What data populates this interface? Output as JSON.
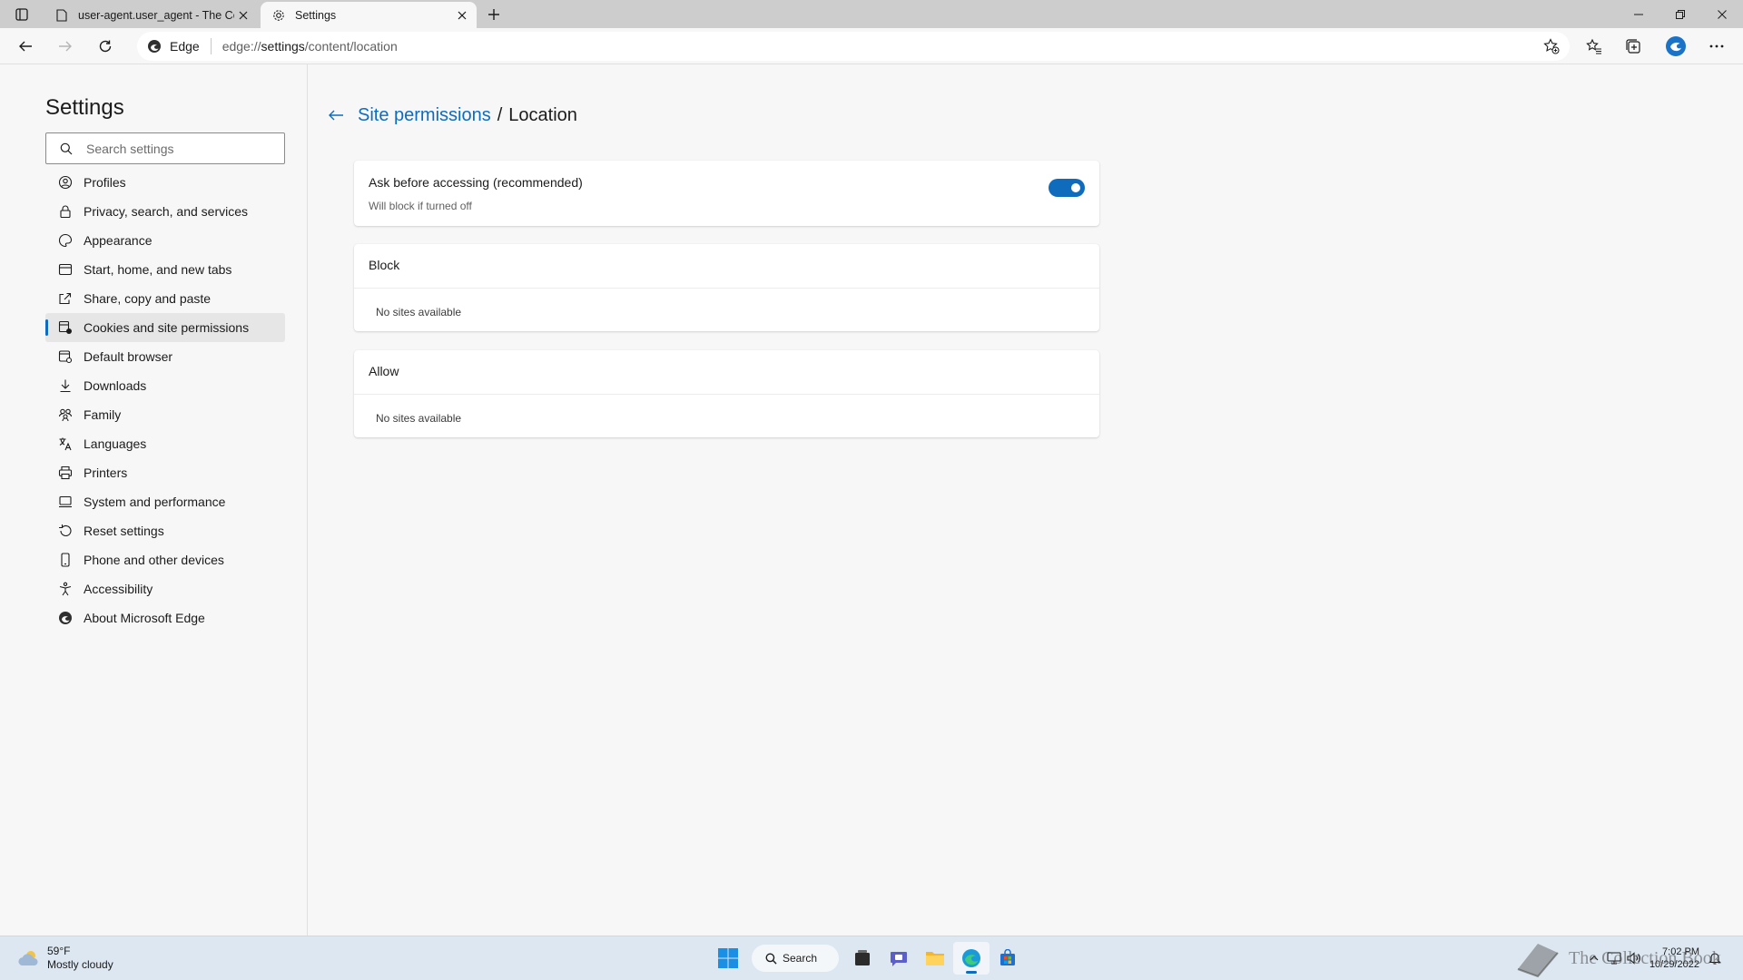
{
  "browser": {
    "tabs": [
      {
        "title": "user-agent.user_agent - The Coll",
        "active": false,
        "icon": "page-icon"
      },
      {
        "title": "Settings",
        "active": true,
        "icon": "gear-icon"
      }
    ],
    "address_label": "Edge",
    "url_prefix": "edge://",
    "url_main": "settings",
    "url_rest": "/content/location"
  },
  "sidebar": {
    "title": "Settings",
    "search_placeholder": "Search settings",
    "items": [
      {
        "label": "Profiles",
        "icon": "profile-icon"
      },
      {
        "label": "Privacy, search, and services",
        "icon": "lock-icon"
      },
      {
        "label": "Appearance",
        "icon": "appearance-icon"
      },
      {
        "label": "Start, home, and new tabs",
        "icon": "home-tabs-icon"
      },
      {
        "label": "Share, copy and paste",
        "icon": "share-icon"
      },
      {
        "label": "Cookies and site permissions",
        "icon": "cookies-icon",
        "selected": true
      },
      {
        "label": "Default browser",
        "icon": "browser-icon"
      },
      {
        "label": "Downloads",
        "icon": "download-icon"
      },
      {
        "label": "Family",
        "icon": "family-icon"
      },
      {
        "label": "Languages",
        "icon": "languages-icon"
      },
      {
        "label": "Printers",
        "icon": "printer-icon"
      },
      {
        "label": "System and performance",
        "icon": "system-icon"
      },
      {
        "label": "Reset settings",
        "icon": "reset-icon"
      },
      {
        "label": "Phone and other devices",
        "icon": "phone-icon"
      },
      {
        "label": "Accessibility",
        "icon": "accessibility-icon"
      },
      {
        "label": "About Microsoft Edge",
        "icon": "edge-icon"
      }
    ]
  },
  "main": {
    "breadcrumb_link": "Site permissions",
    "breadcrumb_sep": "/",
    "breadcrumb_current": "Location",
    "ask": {
      "title": "Ask before accessing (recommended)",
      "subtitle": "Will block if turned off",
      "enabled": true
    },
    "block": {
      "heading": "Block",
      "empty": "No sites available"
    },
    "allow": {
      "heading": "Allow",
      "empty": "No sites available"
    }
  },
  "taskbar": {
    "weather_temp": "59°F",
    "weather_desc": "Mostly cloudy",
    "search_label": "Search",
    "time": "7:02 PM",
    "date": "10/29/2022"
  },
  "watermark": "The Collection Book",
  "colors": {
    "accent": "#0f6cbd",
    "taskbar": "#dde7f1",
    "tabstrip": "#cdcdcd"
  }
}
